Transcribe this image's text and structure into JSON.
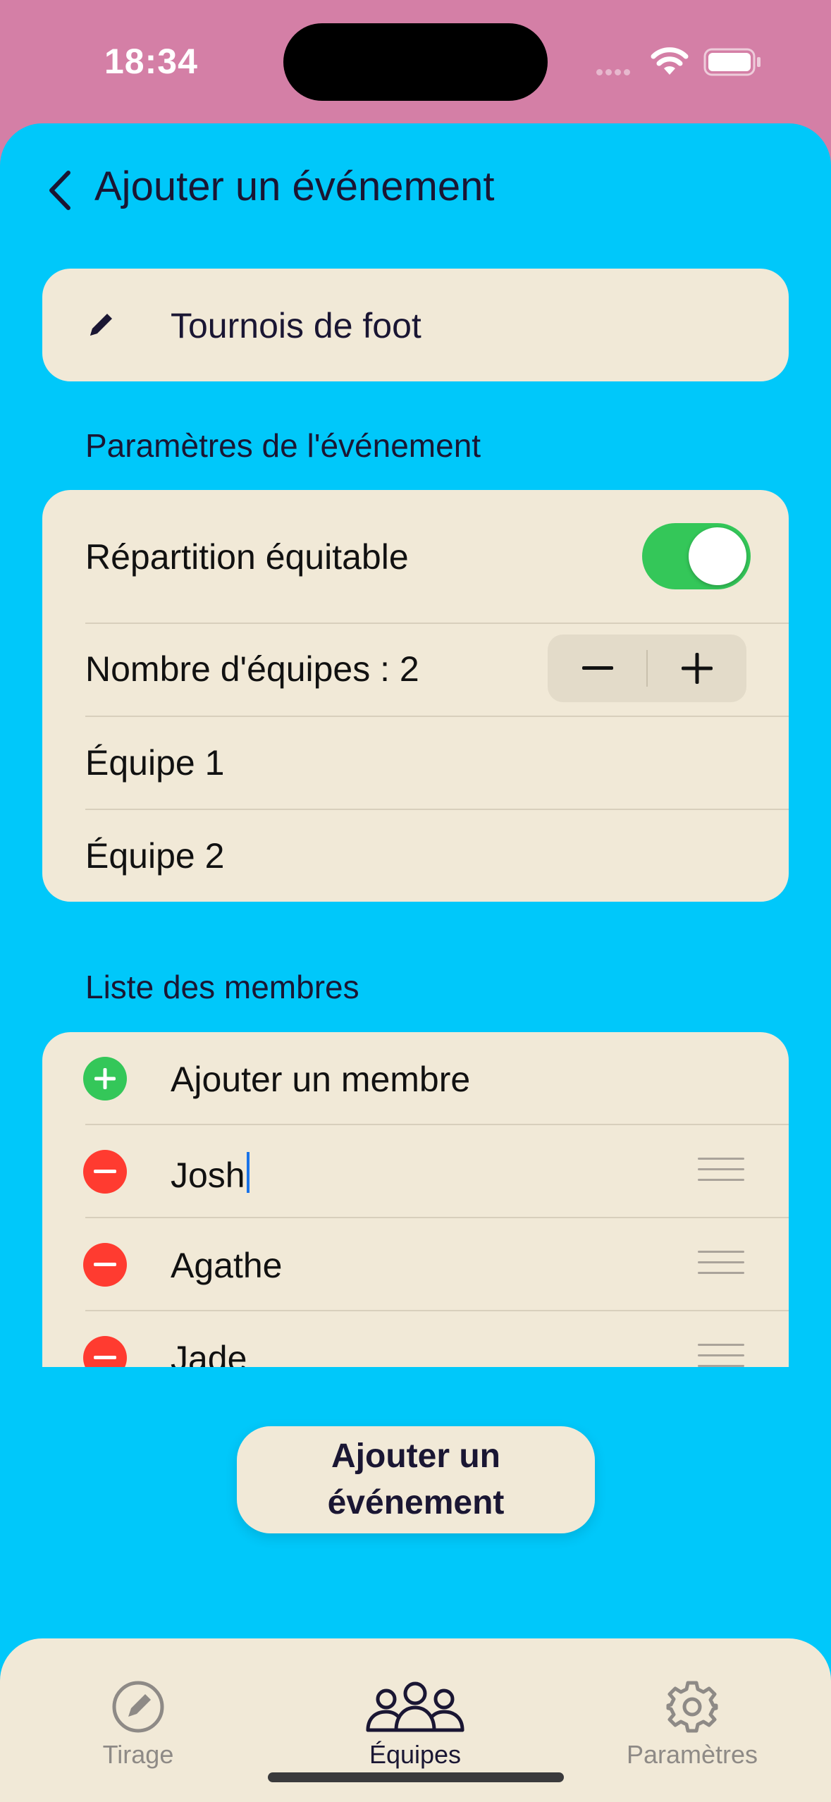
{
  "status_bar": {
    "time": "18:34"
  },
  "nav": {
    "title": "Ajouter un événement",
    "back_icon": "chevron-left-icon"
  },
  "event": {
    "name": "Tournois de foot",
    "edit_icon": "pencil-icon"
  },
  "params": {
    "section_title": "Paramètres de l'événement",
    "fair_split_label": "Répartition équitable",
    "fair_split_on": true,
    "team_count_label": "Nombre d'équipes : 2",
    "teams": [
      "Équipe 1",
      "Équipe 2"
    ]
  },
  "members": {
    "section_title": "Liste des membres",
    "add_label": "Ajouter un membre",
    "items": [
      "Josh",
      "Agathe",
      "Jade"
    ]
  },
  "primary_button": {
    "label": "Ajouter un événement"
  },
  "tabs": [
    {
      "label": "Tirage",
      "icon": "compass-icon",
      "active": false
    },
    {
      "label": "Équipes",
      "icon": "people-icon",
      "active": true
    },
    {
      "label": "Paramètres",
      "icon": "gear-icon",
      "active": false
    }
  ],
  "colors": {
    "status_background": "#d47fa6",
    "sheet_background": "#00c8fa",
    "card_background": "#f1e9d7",
    "toggle_on": "#34c759",
    "add_green": "#34c759",
    "remove_red": "#ff3b30",
    "text_dark": "#1a1633"
  }
}
